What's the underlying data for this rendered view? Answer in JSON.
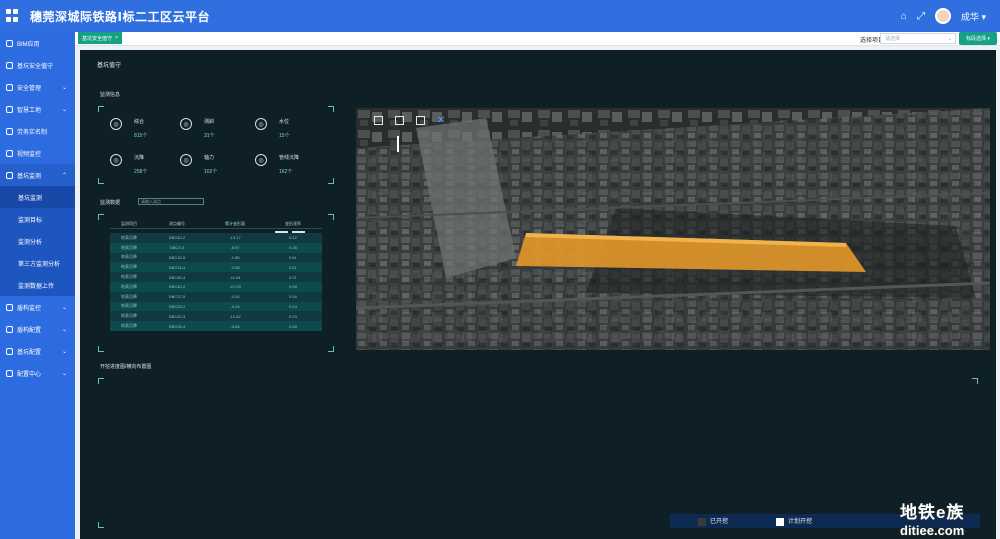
{
  "header": {
    "title": "穗莞深城际铁路Ⅰ标二工区云平台",
    "user": "成华"
  },
  "sidebar": {
    "items": [
      {
        "label": "BIM应用",
        "icon": "monitor-icon",
        "arrow": ""
      },
      {
        "label": "基坑安全值守",
        "icon": "circle-icon",
        "arrow": ""
      },
      {
        "label": "安全管理",
        "icon": "shield-icon",
        "arrow": "⌄"
      },
      {
        "label": "智慧工地",
        "icon": "building-icon",
        "arrow": "⌄"
      },
      {
        "label": "劳务实名制",
        "icon": "id-card-icon",
        "arrow": ""
      },
      {
        "label": "视频监控",
        "icon": "video-icon",
        "arrow": ""
      },
      {
        "label": "基坑监测",
        "icon": "gear-icon",
        "arrow": "⌃"
      }
    ],
    "subitems": [
      "基坑监测",
      "监测目标",
      "监测分析",
      "第三方监测分析",
      "监测数据上传"
    ],
    "items_after": [
      {
        "label": "盾构监控",
        "icon": "gear-icon",
        "arrow": "⌄"
      },
      {
        "label": "盾构配置",
        "icon": "gear-icon",
        "arrow": "⌄"
      },
      {
        "label": "基坑配置",
        "icon": "gear-icon",
        "arrow": "⌄"
      },
      {
        "label": "配置中心",
        "icon": "gear-icon",
        "arrow": "⌄"
      }
    ]
  },
  "tabs": {
    "active_tab": "基坑安全值守",
    "project_label": "选择项目：",
    "project_placeholder": "请选择",
    "switch_button": "标段选择"
  },
  "page": {
    "title": "基坑值守",
    "monitor_section": "监测信息",
    "data_section": "监测数据",
    "search_placeholder": "请输入测点",
    "chart_section": "开挖进度图/横向布置图"
  },
  "stats": [
    {
      "name": "综合",
      "value": "815个",
      "icon": "grid-icon"
    },
    {
      "name": "测斜",
      "value": "31个",
      "icon": "incline-icon"
    },
    {
      "name": "水位",
      "value": "15个",
      "icon": "water-icon"
    },
    {
      "name": "沉降",
      "value": "258个",
      "icon": "settle-icon"
    },
    {
      "name": "轴力",
      "value": "102个",
      "icon": "force-icon"
    },
    {
      "name": "管线沉降",
      "value": "162个",
      "icon": "pipe-icon"
    }
  ],
  "table": {
    "headers": [
      "监测项目",
      "测点编号",
      "累计变形量",
      "变形速率"
    ],
    "rows": [
      [
        "地表沉降",
        "DBC42-2",
        "-13.17",
        "0.12"
      ],
      [
        "地表沉降",
        "DBC9-3",
        "-8.97",
        "0.26"
      ],
      [
        "地表沉降",
        "DBC15-5",
        "-1.85",
        "0.61"
      ],
      [
        "地表沉降",
        "DBC14-4",
        "-2.08",
        "0.21"
      ],
      [
        "地表沉降",
        "DBC30-4",
        "-11.64",
        "0.21"
      ],
      [
        "地表沉降",
        "DBC40-2",
        "-21.03",
        "0.08"
      ],
      [
        "地表沉降",
        "DBC27-5",
        "-4.20",
        "0.16"
      ],
      [
        "地表沉降",
        "DBC23-2",
        "-4.19",
        "0.14"
      ],
      [
        "地表沉降",
        "DBC42-3",
        "-12.62",
        "0.23"
      ],
      [
        "地表沉降",
        "DBC26-4",
        "-3.56",
        "0.45"
      ]
    ]
  },
  "legend": {
    "opened": "已开挖",
    "planned": "计划开挖",
    "opened_color": "#3a3a3a",
    "planned_color": "#ffffff"
  },
  "watermark": {
    "cn": "地铁e族",
    "en": "ditiee.com"
  },
  "colors": {
    "header_blue": "#2f6fe0",
    "accent_teal": "#16a085",
    "panel_bg": "#0f1f26",
    "highlight_orange": "#e0962a"
  }
}
